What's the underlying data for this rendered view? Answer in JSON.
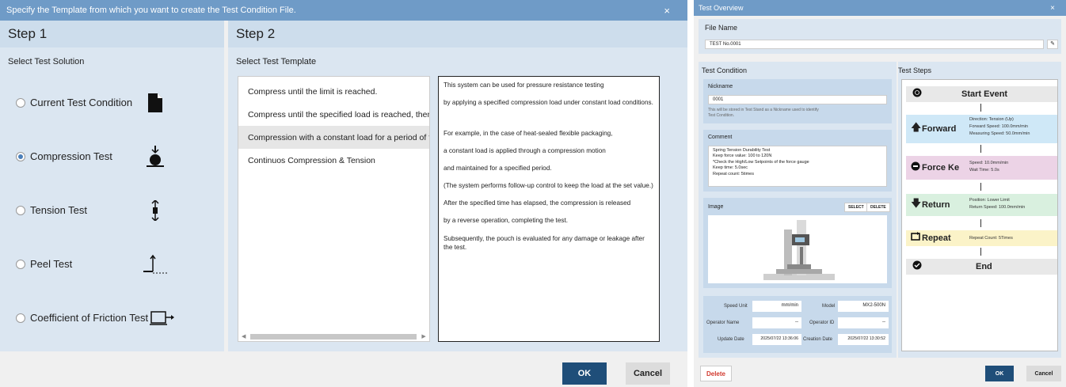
{
  "dialog1": {
    "title": "Specify the Template from which you want to create the Test Condition File.",
    "close": "×",
    "step1": {
      "heading": "Step 1",
      "sublabel": "Select Test Solution",
      "options": [
        {
          "label": "Current Test Condition",
          "selected": false,
          "icon": "document-icon"
        },
        {
          "label": "Compression Test",
          "selected": true,
          "icon": "compression-icon"
        },
        {
          "label": "Tension Test",
          "selected": false,
          "icon": "tension-icon"
        },
        {
          "label": "Peel Test",
          "selected": false,
          "icon": "peel-icon"
        },
        {
          "label": "Coefficient of Friction Test",
          "selected": false,
          "icon": "friction-icon"
        }
      ]
    },
    "step2": {
      "heading": "Step 2",
      "sublabel": "Select Test Template",
      "templates": [
        {
          "label": "Compress until the limit is reached.",
          "selected": false
        },
        {
          "label": "Compress until the specified load is reached, then retu",
          "selected": false
        },
        {
          "label": "Compression with a constant load for a period of time",
          "selected": true
        },
        {
          "label": "Continuos Compression & Tension",
          "selected": false
        }
      ],
      "description": [
        "This system can be used for pressure resistance testing",
        "by applying a specified compression load under constant load conditions.",
        "",
        "For example, in the case of heat-sealed flexible packaging,",
        "a constant load is applied through a compression motion",
        "and maintained for a specified period.",
        "(The system performs follow-up control to keep the load at the set value.)",
        "After the specified time has elapsed, the compression is released",
        "by a reverse operation, completing the test.",
        "Subsequently, the pouch is evaluated for any damage or leakage after the test."
      ]
    },
    "ok_label": "OK",
    "cancel_label": "Cancel"
  },
  "dialog2": {
    "title": "Test Overview",
    "close": "×",
    "file_name_label": "File Name",
    "file_name_value": "TEST No.0001",
    "test_condition_label": "Test Condition",
    "test_steps_label": "Test Steps",
    "nickname_label": "Nickname",
    "nickname_value": "0001",
    "nickname_hint": "This will be stored in Test Stand as a Nickname used to identify Test Condition.",
    "comment_label": "Comment",
    "comment_lines": [
      "Spring Tension Durability Test",
      "Keep force value: 100 to 120N",
      "*Check the High/Low Setpoints of the force gauge",
      "Keep time: 5.0sec",
      "Repeat count: 5times"
    ],
    "image_label": "Image",
    "select_label": "SELECT",
    "delete_small_label": "DELETE",
    "info": {
      "speed_unit_label": "Speed Unit",
      "speed_unit_value": "mm/min",
      "model_label": "Model",
      "model_value": "MX2-500N",
      "operator_name_label": "Operator Name",
      "operator_name_value": "--",
      "operator_id_label": "Operator ID",
      "operator_id_value": "--",
      "update_date_label": "Update Date",
      "update_date_value": "2025/07/22 13:36:06",
      "creation_date_label": "Creation Date",
      "creation_date_value": "2025/07/22 13:30:52"
    },
    "steps": [
      {
        "name": "Start Event",
        "info": [],
        "color": "#e8e8e8",
        "icon": "record-icon"
      },
      {
        "name": "Forward",
        "info": [
          "Direction: Tension (Up)",
          "Forward Speed: 100.0mm/min",
          "Measuring Speed: 50.0mm/min"
        ],
        "color": "#cfe8f7",
        "icon": "arrow-up-icon"
      },
      {
        "name": "Force Ke",
        "info": [
          "Speed: 10.0mm/min",
          "Wait Time: 5.0s"
        ],
        "color": "#ecd3e6",
        "icon": "force-keep-icon"
      },
      {
        "name": "Return",
        "info": [
          "Position: Lower Limit",
          "Return Speed: 100.0mm/min"
        ],
        "color": "#d9f0df",
        "icon": "arrow-down-icon"
      },
      {
        "name": "Repeat",
        "info": [
          "Repeat Count: 5Times"
        ],
        "color": "#fbf3c8",
        "icon": "repeat-icon"
      },
      {
        "name": "End",
        "info": [],
        "color": "#e8e8e8",
        "icon": "check-icon"
      }
    ],
    "delete_label": "Delete",
    "ok_label": "OK",
    "cancel_label": "Cancel"
  }
}
